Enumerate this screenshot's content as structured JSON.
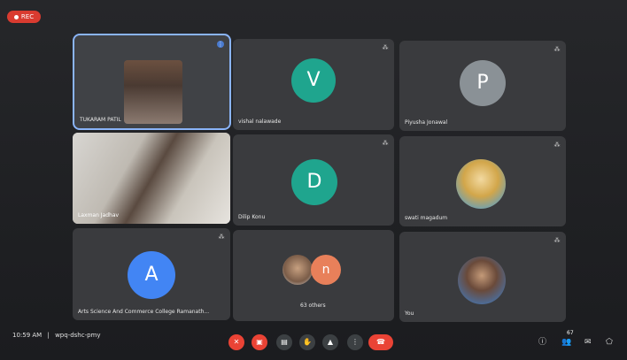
{
  "recording": {
    "label": "REC"
  },
  "tiles": [
    {
      "name": "TUKARAM PATIL"
    },
    {
      "name": "vishal nalawade",
      "initial": "V"
    },
    {
      "name": "Piyusha Jonawal",
      "initial": "P"
    },
    {
      "name": "Laxman Jadhav"
    },
    {
      "name": "Dilip Konu",
      "initial": "D"
    },
    {
      "name": "swati magadum"
    },
    {
      "name": "Arts Science And Commerce College Ramanath...",
      "initial": "A"
    },
    {
      "name": "63 others",
      "initial": "n"
    },
    {
      "name": "You"
    }
  ],
  "footer": {
    "time": "10:59 AM",
    "meeting_code": "wpq-dshc-pmy",
    "people_count": "67"
  },
  "colors": {
    "teal": "#1fa58e",
    "grey": "#8a9196",
    "blue": "#4285f4",
    "red": "#ea4335",
    "orange": "#e8805a"
  },
  "icons": [
    "mic-off-icon",
    "camera-off-icon",
    "captions-icon",
    "raise-hand-icon",
    "present-icon",
    "more-icon",
    "end-call-icon",
    "info-icon",
    "people-icon",
    "chat-icon",
    "activities-icon"
  ]
}
